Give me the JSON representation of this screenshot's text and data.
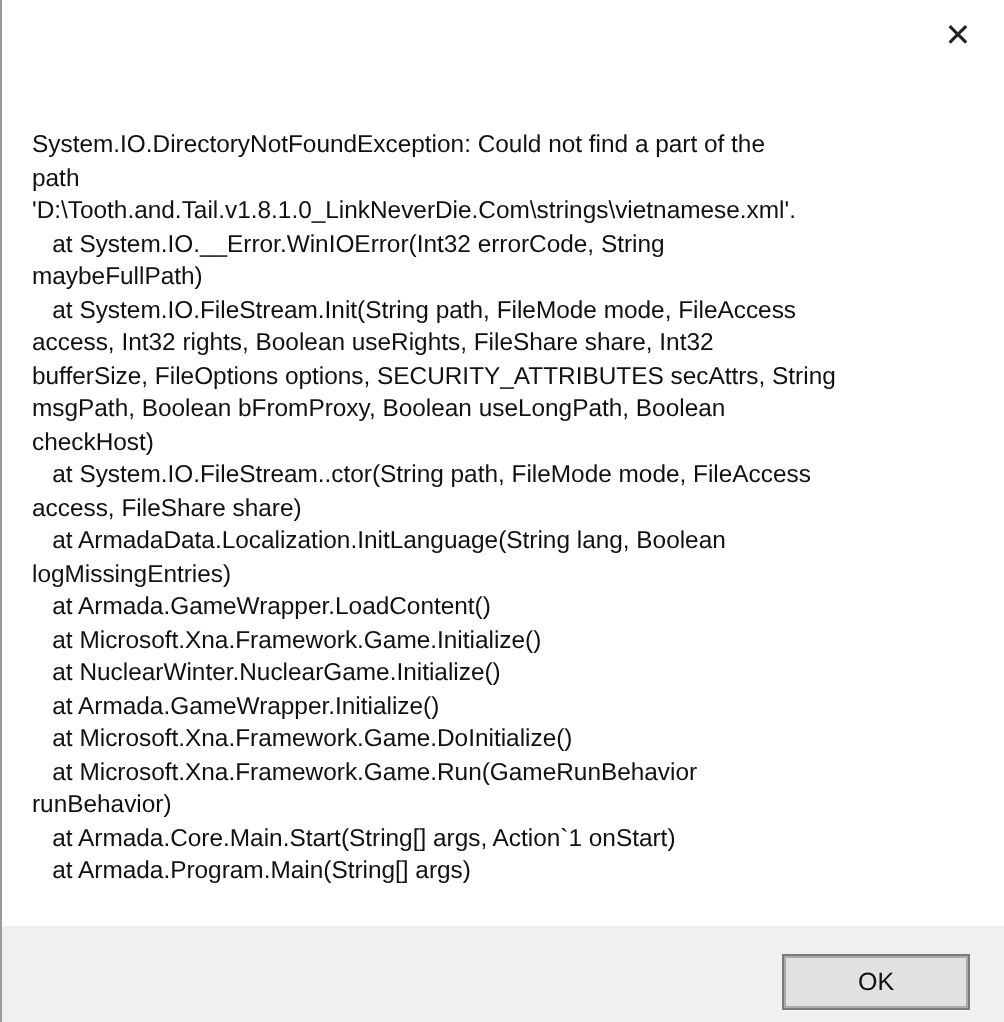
{
  "window": {
    "close_glyph": "✕"
  },
  "message_lines": [
    "System.IO.DirectoryNotFoundException: Could not find a part of the",
    "path",
    "'D:\\Tooth.and.Tail.v1.8.1.0_LinkNeverDie.Com\\strings\\vietnamese.xml'.",
    "   at System.IO.__Error.WinIOError(Int32 errorCode, String",
    "maybeFullPath)",
    "   at System.IO.FileStream.Init(String path, FileMode mode, FileAccess",
    "access, Int32 rights, Boolean useRights, FileShare share, Int32",
    "bufferSize, FileOptions options, SECURITY_ATTRIBUTES secAttrs, String",
    "msgPath, Boolean bFromProxy, Boolean useLongPath, Boolean",
    "checkHost)",
    "   at System.IO.FileStream..ctor(String path, FileMode mode, FileAccess",
    "access, FileShare share)",
    "   at ArmadaData.Localization.InitLanguage(String lang, Boolean",
    "logMissingEntries)",
    "   at Armada.GameWrapper.LoadContent()",
    "   at Microsoft.Xna.Framework.Game.Initialize()",
    "   at NuclearWinter.NuclearGame.Initialize()",
    "   at Armada.GameWrapper.Initialize()",
    "   at Microsoft.Xna.Framework.Game.DoInitialize()",
    "   at Microsoft.Xna.Framework.Game.Run(GameRunBehavior",
    "runBehavior)",
    "   at Armada.Core.Main.Start(String[] args, Action`1 onStart)",
    "   at Armada.Program.Main(String[] args)"
  ],
  "buttons": [
    {
      "label": "OK"
    }
  ]
}
